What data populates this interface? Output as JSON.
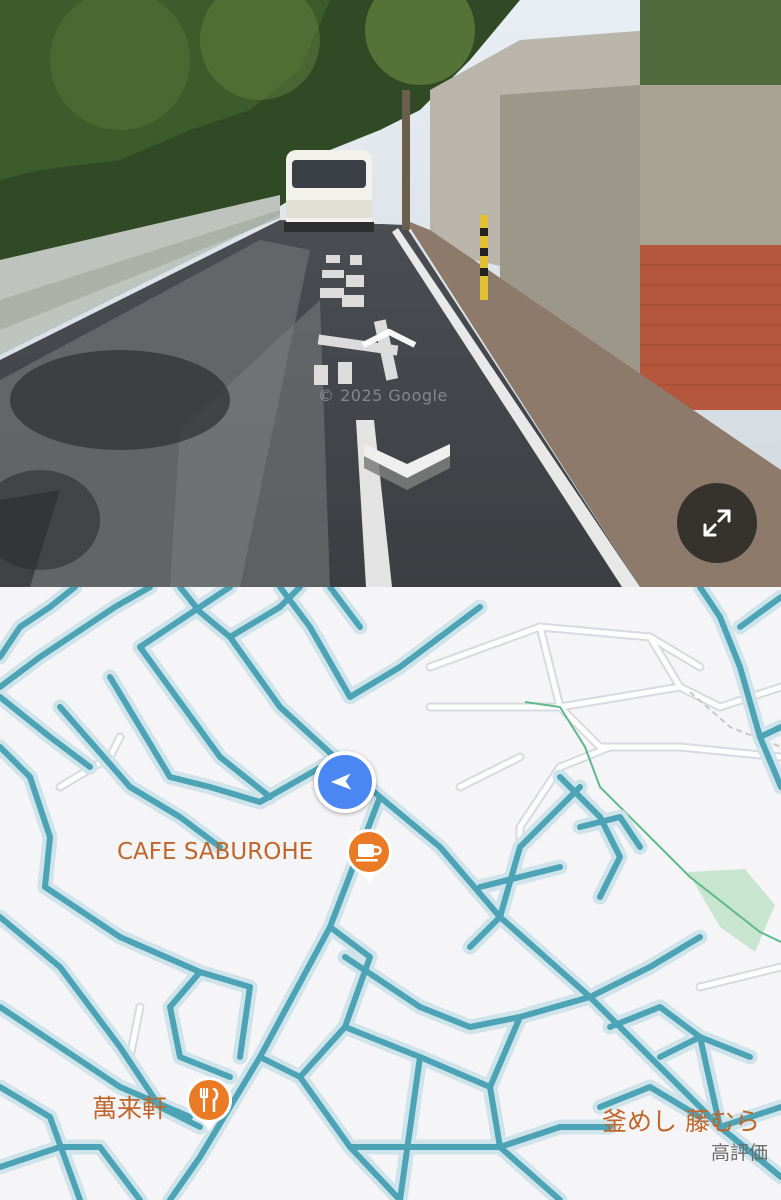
{
  "street_view": {
    "watermark": "© 2025 Google",
    "road_marking": "4",
    "forward_arrow_icon": "chevron-up-icon",
    "back_arrow_icon": "chevron-down-icon",
    "expand_icon": "expand-icon"
  },
  "map": {
    "road_color": "#4ba3b5",
    "road_casing_color": "#cfe4ea",
    "location_icon": "navigation-arrow-icon",
    "pois": [
      {
        "name": "CAFE SABUROHE",
        "icon": "cafe-icon"
      },
      {
        "name": "萬来軒",
        "icon": "restaurant-icon"
      },
      {
        "name": "釜めし 藤むら",
        "sub": "高評価"
      }
    ]
  }
}
